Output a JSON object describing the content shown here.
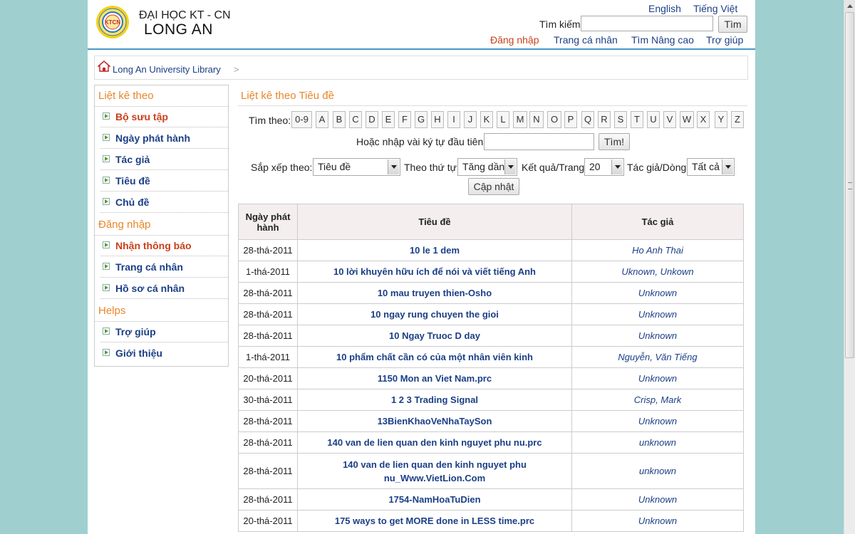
{
  "header": {
    "logo_text": "KTCN",
    "brand_line1": "ĐẠI HỌC KT - CN",
    "brand_line2": "LONG AN",
    "lang_en": "English",
    "lang_vi": "Tiếng Việt",
    "search_label": "Tìm kiếm",
    "search_value": "",
    "search_button": "Tìm",
    "links": {
      "login": "Đăng nhập",
      "profile": "Trang cá nhân",
      "advanced": "Tìm Nâng cao",
      "help": "Trợ giúp"
    }
  },
  "breadcrumb": {
    "home": "Long An University Library",
    "separator": ">"
  },
  "sidebar": {
    "heading_browse": "Liệt kê theo",
    "browse_items": [
      "Bộ sưu tập",
      "Ngày phát hành",
      "Tác giả",
      "Tiêu đề",
      "Chủ đề"
    ],
    "heading_login": "Đăng nhập",
    "login_items": [
      "Nhận thông báo",
      "Trang cá nhân",
      "Hồ sơ cá nhân"
    ],
    "heading_helps": "Helps",
    "help_items": [
      "Trợ giúp",
      "Giới thiệu"
    ]
  },
  "main": {
    "title": "Liệt kê theo Tiêu đề",
    "jump_label": "Tìm theo:",
    "letters": [
      "0-9",
      "A",
      "B",
      "C",
      "D",
      "E",
      "F",
      "G",
      "H",
      "I",
      "J",
      "K",
      "L",
      "M",
      "N",
      "O",
      "P",
      "Q",
      "R",
      "S",
      "T",
      "U",
      "V",
      "W",
      "X",
      "Y",
      "Z"
    ],
    "first_chars_label": "Hoặc nhập vài ký tự đầu tiên:",
    "first_chars_value": "",
    "find_button": "Tìm!",
    "sort_by_label": "Sắp xếp theo:",
    "sort_by_value": "Tiêu đề",
    "order_label": "Theo thứ tự",
    "order_value": "Tăng dần",
    "rpp_label": "Kết quả/Trang",
    "rpp_value": "20",
    "authors_label": "Tác giả/Dòng",
    "authors_value": "Tất cả",
    "update_button": "Cập nhật"
  },
  "table": {
    "headers": {
      "date": "Ngày phát hành",
      "title": "Tiêu đề",
      "author": "Tác giả"
    },
    "rows": [
      {
        "date": "28-thá-2011",
        "title": "10 le 1 dem",
        "author": "Ho Anh Thai"
      },
      {
        "date": "1-thá-2011",
        "title": "10 lời khuyên hữu ích để nói và viết tiếng Anh",
        "author": "Uknown, Unkown"
      },
      {
        "date": "28-thá-2011",
        "title": "10 mau truyen thien-Osho",
        "author": "Unknown"
      },
      {
        "date": "28-thá-2011",
        "title": "10 ngay rung chuyen the gioi",
        "author": "Unknown"
      },
      {
        "date": "28-thá-2011",
        "title": "10 Ngay Truoc D day",
        "author": "Unknown"
      },
      {
        "date": "1-thá-2011",
        "title": "10 phẩm chất cần có của một nhân viên kinh",
        "author": "Nguyễn, Văn Tiếng"
      },
      {
        "date": "20-thá-2011",
        "title": "1150 Mon an Viet Nam.prc",
        "author": "Unknown"
      },
      {
        "date": "30-thá-2011",
        "title": "1 2 3 Trading Signal",
        "author": "Crisp, Mark"
      },
      {
        "date": "28-thá-2011",
        "title": "13BienKhaoVeNhaTaySon",
        "author": "Unknown"
      },
      {
        "date": "28-thá-2011",
        "title": "140 van de lien quan den kinh nguyet phu nu.prc",
        "author": "unknown"
      },
      {
        "date": "28-thá-2011",
        "title_line1": "140 van de lien quan den kinh nguyet phu",
        "title_line2": "nu_Www.VietLion.Com",
        "author": "unknown"
      },
      {
        "date": "28-thá-2011",
        "title": "1754-NamHoaTuDien",
        "author": "Unknown"
      },
      {
        "date": "20-thá-2011",
        "title": "175 ways to get MORE done in LESS time.prc",
        "author": "Unknown"
      }
    ]
  }
}
